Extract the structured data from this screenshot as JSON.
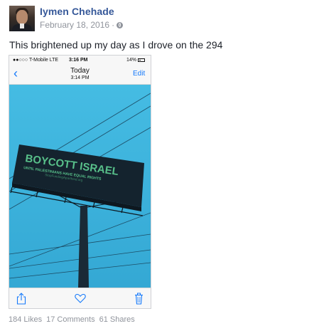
{
  "post": {
    "author": "Iymen Chehade",
    "date": "February 18, 2016",
    "separator": "·",
    "audience_icon": "globe-icon",
    "text": "This brightened up my day as I drove on the 294"
  },
  "phone": {
    "carrier": "●●○○○ T-Mobile  LTE",
    "time": "3:16 PM",
    "battery": "14%",
    "nav_title": "Today",
    "nav_subtitle": "3:14 PM",
    "edit": "Edit",
    "billboard_line1": "BOYCOTT ISRAEL",
    "billboard_line2": "UNTIL PALESTINIANS HAVE EQUAL RIGHTS",
    "billboard_line3": "StopFundingApartheid.org",
    "icons": [
      "back-chevron-icon",
      "share-icon",
      "heart-icon",
      "trash-icon"
    ]
  },
  "stats": {
    "likes": "184 Likes",
    "comments": "17 Comments",
    "shares": "61 Shares"
  },
  "colors": {
    "author": "#365899",
    "meta": "#90949c",
    "ios_blue": "#1479fb",
    "sky": "#3fb6de"
  }
}
